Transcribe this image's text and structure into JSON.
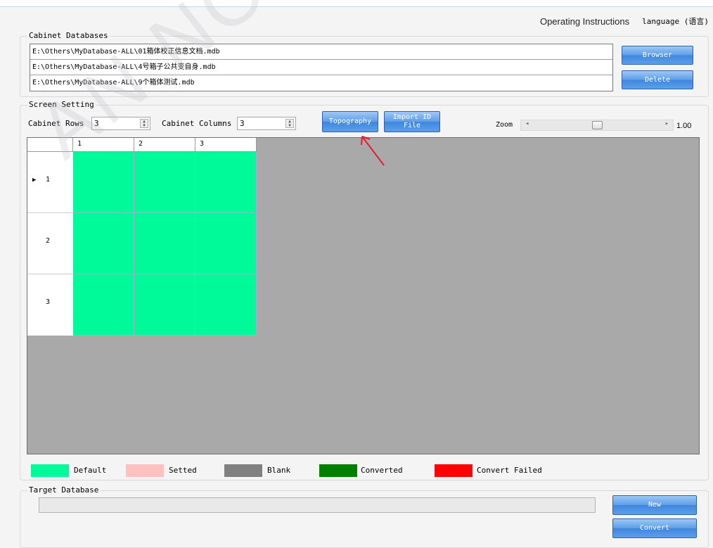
{
  "header": {
    "operating_instructions": "Operating Instructions",
    "language": "language (语言)"
  },
  "cabinet_databases": {
    "title": "Cabinet Databases",
    "files": [
      "E:\\Others\\MyDatabase-ALL\\01箱体校正信息文档.mdb",
      "E:\\Others\\MyDatabase-ALL\\4号箱子公共变自身.mdb",
      "E:\\Others\\MyDatabase-ALL\\9个箱体测试.mdb"
    ],
    "browser_label": "Browser",
    "delete_label": "Delete"
  },
  "screen_setting": {
    "title": "Screen Setting",
    "rows_label": "Cabinet Rows",
    "rows_value": "3",
    "columns_label": "Cabinet Columns",
    "columns_value": "3",
    "topography_label": "Topography",
    "import_label_1": "Import ID",
    "import_label_2": "File",
    "zoom_label": "Zoom",
    "zoom_value": "1.00",
    "zoom_fraction": 0.5
  },
  "grid": {
    "column_headers": [
      "1",
      "2",
      "3"
    ],
    "row_headers": [
      "1",
      "2",
      "3"
    ],
    "current_row_marker": "▶",
    "cell_color": "#00FA9A"
  },
  "legend": [
    {
      "label": "Default",
      "color": "#00FA9A"
    },
    {
      "label": "Setted",
      "color": "#FFC0C0"
    },
    {
      "label": "Blank",
      "color": "#808080"
    },
    {
      "label": "Converted",
      "color": "#008000"
    },
    {
      "label": "Convert Failed",
      "color": "#FF0000"
    }
  ],
  "target_database": {
    "title": "Target Database",
    "value": "",
    "new_label": "New",
    "convert_label": "Convert"
  },
  "watermark": "AN NOVASTAR",
  "colors": {
    "button_blue": "#3F86DF",
    "canvas_gray": "#A9A9A9",
    "annotation_arrow": "#E0202A"
  }
}
